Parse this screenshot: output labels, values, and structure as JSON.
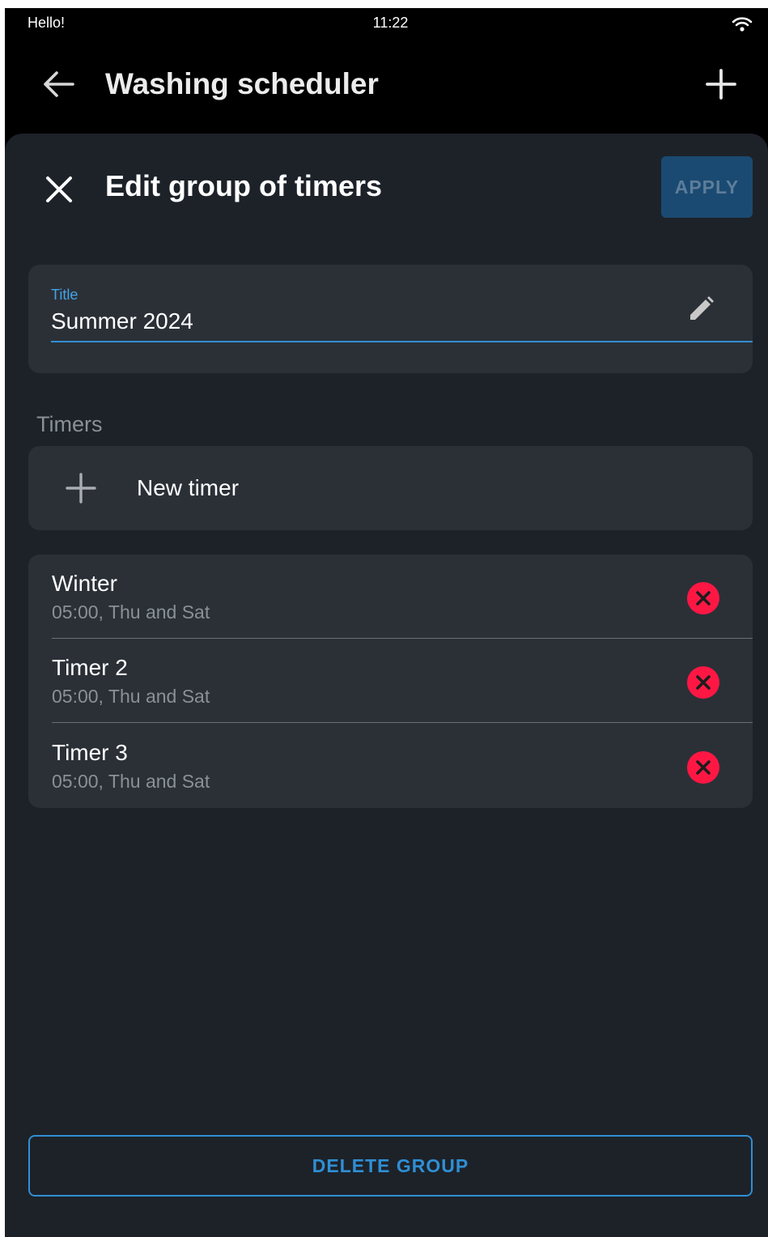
{
  "status_bar": {
    "greeting": "Hello!",
    "time": "11:22"
  },
  "app_bar": {
    "title": "Washing scheduler"
  },
  "sheet": {
    "title": "Edit group of timers",
    "apply_label": "APPLY",
    "title_field": {
      "label": "Title",
      "value": "Summer 2024"
    },
    "timers_section_label": "Timers",
    "new_timer_label": "New timer",
    "timers": [
      {
        "name": "Winter",
        "schedule": "05:00, Thu and Sat"
      },
      {
        "name": "Timer 2",
        "schedule": "05:00, Thu and Sat"
      },
      {
        "name": "Timer 3",
        "schedule": "05:00, Thu and Sat"
      }
    ],
    "delete_group_label": "DELETE GROUP"
  },
  "colors": {
    "accent": "#2f8fd4",
    "delete_icon": "#ff1744",
    "sheet_bg": "#1d2229",
    "card_bg": "#2b3037"
  },
  "icons": {
    "back": "arrow-left-icon",
    "add": "plus-icon",
    "close": "close-icon",
    "edit": "pencil-icon",
    "remove": "remove-circle-icon",
    "wifi": "wifi-icon"
  }
}
